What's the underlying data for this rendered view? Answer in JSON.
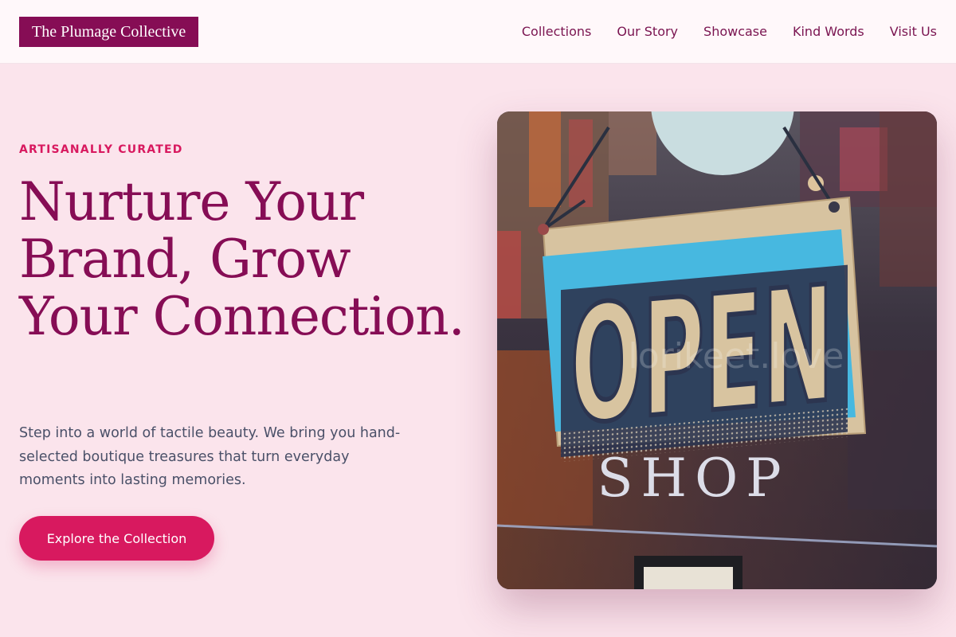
{
  "header": {
    "logo": "The Plumage Collective",
    "nav": [
      {
        "label": "Collections"
      },
      {
        "label": "Our Story"
      },
      {
        "label": "Showcase"
      },
      {
        "label": "Kind Words"
      },
      {
        "label": "Visit Us"
      }
    ]
  },
  "hero": {
    "eyebrow": "ARTISANALLY CURATED",
    "headline": "Nurture Your Brand, Grow Your Connection.",
    "description": "Step into a world of tactile beauty. We bring you hand-selected boutique treasures that turn everyday moments into lasting memories.",
    "cta_label": "Explore the Collection",
    "image": {
      "sign_text": "OPEN",
      "window_text": "SHOP",
      "watermark": "lorikeet.love"
    }
  },
  "colors": {
    "brand": "#860d55",
    "accent": "#d8195f",
    "background": "#fbe4ec",
    "header_bg": "#fff8fa",
    "body_text": "#4a5068"
  }
}
